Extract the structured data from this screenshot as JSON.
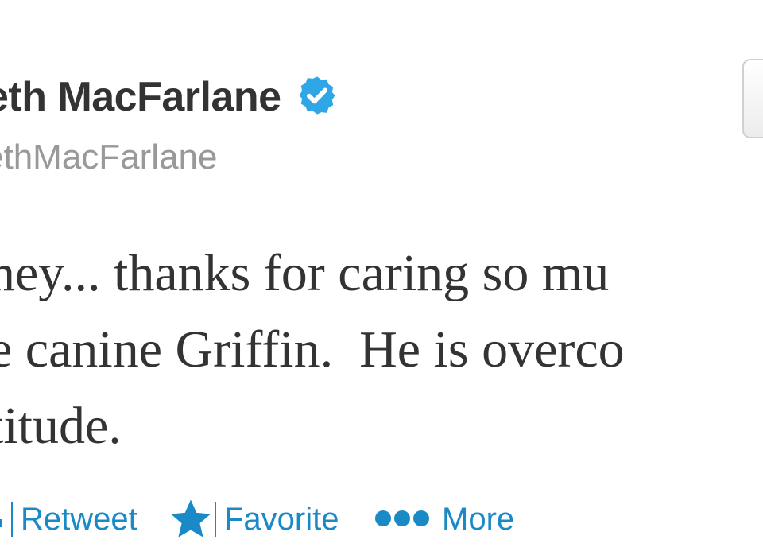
{
  "tweet": {
    "author": {
      "display_name": "eth MacFarlane",
      "screen_name": "ethMacFarlane",
      "verified": true,
      "verified_icon": "verified-badge-icon"
    },
    "text_lines": [
      "ney... thanks for caring so mu",
      "e canine Griffin.  He is overco",
      "titude."
    ],
    "actions": {
      "retweet_label": "Retweet",
      "favorite_label": "Favorite",
      "more_label": "More",
      "retweet_icon": "retweet-icon",
      "favorite_icon": "star-icon",
      "more_icon": "ellipsis-icon"
    }
  },
  "colors": {
    "link": "#1a8ac6",
    "verified": "#2fa7e6",
    "text": "#333333",
    "muted": "#999999"
  }
}
